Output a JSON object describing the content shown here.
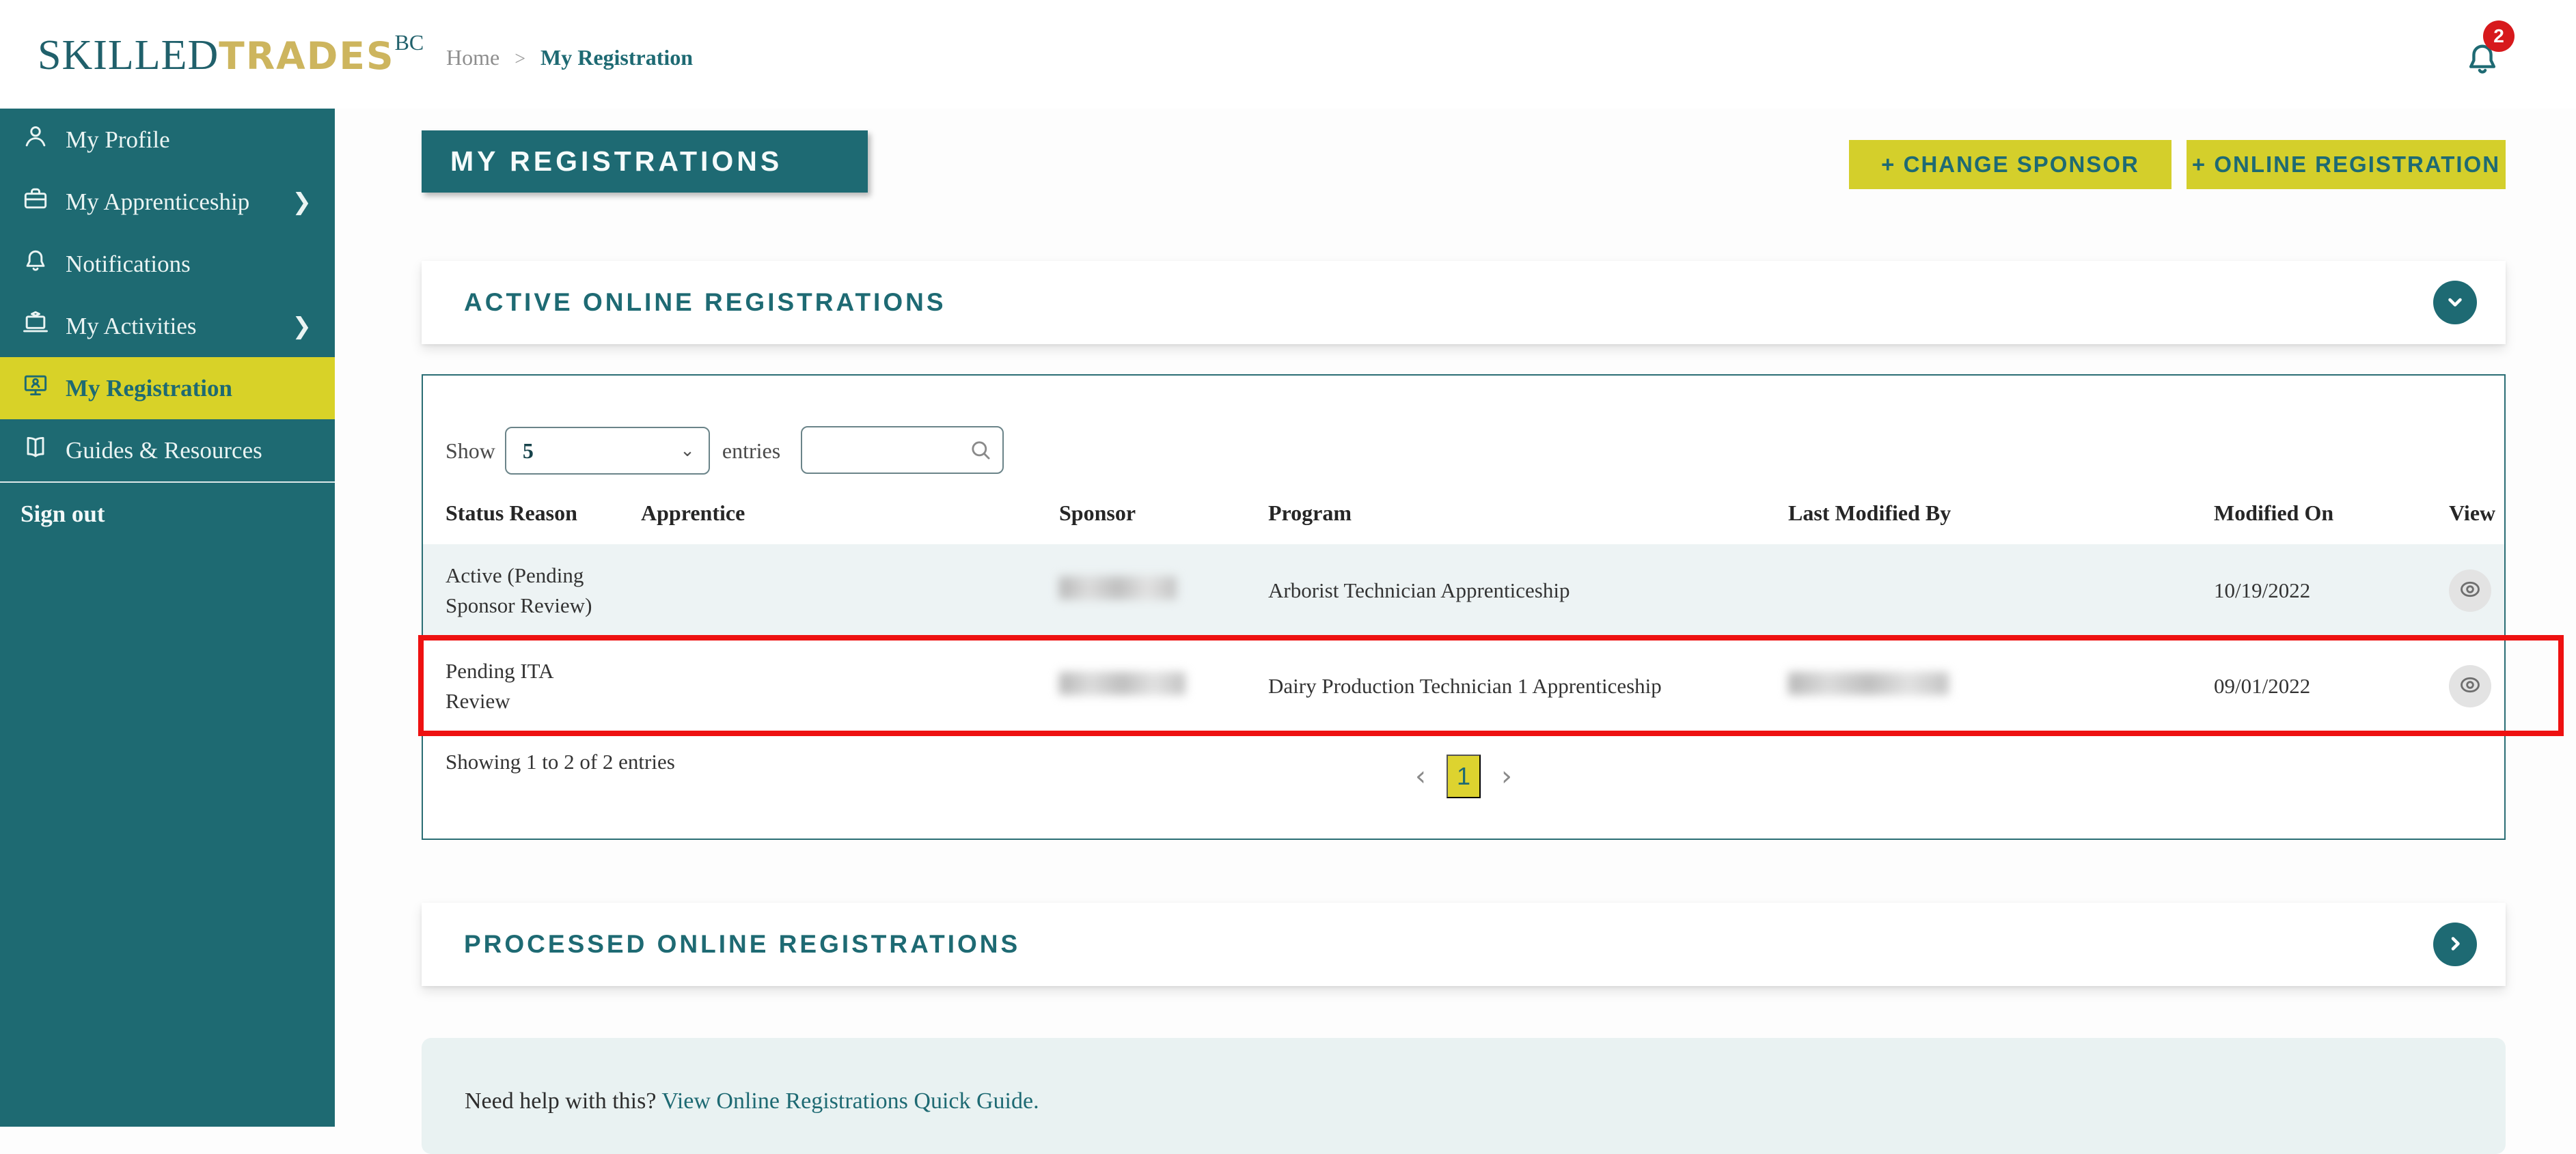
{
  "logo": {
    "part1": "SKILLED",
    "part2": "TRADES",
    "suffix": "BC"
  },
  "header": {
    "breadcrumb": {
      "home": "Home",
      "separator": ">",
      "current": "My Registration"
    },
    "notification_count": "2"
  },
  "sidebar": {
    "items": [
      {
        "label": "My Profile",
        "icon": "person-icon",
        "has_submenu": false,
        "active": false
      },
      {
        "label": "My Apprenticeship",
        "icon": "briefcase-icon",
        "has_submenu": true,
        "active": false
      },
      {
        "label": "Notifications",
        "icon": "bell-icon",
        "has_submenu": false,
        "active": false
      },
      {
        "label": "My Activities",
        "icon": "activities-icon",
        "has_submenu": true,
        "active": false
      },
      {
        "label": "My Registration",
        "icon": "registration-icon",
        "has_submenu": false,
        "active": true
      },
      {
        "label": "Guides & Resources",
        "icon": "book-icon",
        "has_submenu": false,
        "active": false
      }
    ],
    "submenu_arrow": "❯",
    "sign_out": "Sign out"
  },
  "page": {
    "title": "MY REGISTRATIONS",
    "actions": {
      "change_sponsor": "+ CHANGE SPONSOR",
      "online_registration": "+ ONLINE REGISTRATION"
    }
  },
  "active_section": {
    "title": "ACTIVE ONLINE REGISTRATIONS",
    "collapse_icon": "chevron-down-icon",
    "table": {
      "show_label": "Show",
      "page_size": "5",
      "entries_label": "entries",
      "search_value": "",
      "columns": [
        "Status Reason",
        "Apprentice",
        "Sponsor",
        "Program",
        "Last Modified By",
        "Modified On",
        "View"
      ],
      "rows": [
        {
          "status_reason": "Active (Pending Sponsor Review)",
          "apprentice": "",
          "sponsor_redacted": true,
          "program": "Arborist Technician Apprenticeship",
          "last_modified_by": "",
          "modified_on": "10/19/2022",
          "highlighted": false
        },
        {
          "status_reason": "Pending ITA Review",
          "apprentice": "",
          "sponsor_redacted": true,
          "program": "Dairy Production Technician 1 Apprenticeship",
          "last_modified_by_redacted": true,
          "modified_on": "09/01/2022",
          "highlighted": true
        }
      ],
      "summary": "Showing 1 to 2 of 2 entries",
      "pagination": {
        "prev": "‹",
        "current_page": "1",
        "next": "›"
      }
    }
  },
  "processed_section": {
    "title": "PROCESSED ONLINE REGISTRATIONS",
    "expand_icon": "chevron-right-icon"
  },
  "help": {
    "text": "Need help with this? ",
    "link": "View Online Registrations Quick Guide."
  },
  "colors": {
    "teal": "#1E6A72",
    "yellow": "#D4CF2B",
    "active_yellow": "#D8D228",
    "highlight_red": "#EE1111",
    "badge_red": "#D7191C",
    "row_alt": "#EDF3F4",
    "help_bg": "#E9F2F2",
    "logo_gold": "#CDB55E"
  }
}
